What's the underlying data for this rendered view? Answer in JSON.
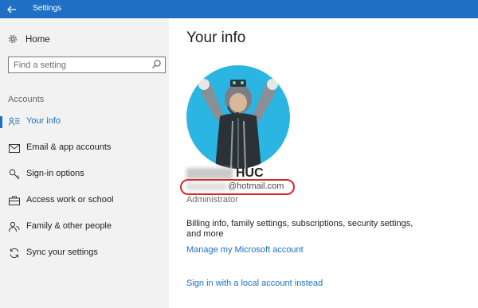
{
  "window": {
    "title": "Settings"
  },
  "sidebar": {
    "home_label": "Home",
    "search_placeholder": "Find a setting",
    "section_label": "Accounts",
    "items": [
      {
        "label": "Your info",
        "icon": "person-lines-icon",
        "active": true
      },
      {
        "label": "Email & app accounts",
        "icon": "mail-icon",
        "active": false
      },
      {
        "label": "Sign-in options",
        "icon": "key-icon",
        "active": false
      },
      {
        "label": "Access work or school",
        "icon": "briefcase-icon",
        "active": false
      },
      {
        "label": "Family & other people",
        "icon": "people-icon",
        "active": false
      },
      {
        "label": "Sync your settings",
        "icon": "sync-icon",
        "active": false
      }
    ]
  },
  "main": {
    "page_title": "Your info",
    "user_name_visible": "HUC",
    "email_visible": "@hotmail.com",
    "role": "Administrator",
    "description": "Billing info, family settings, subscriptions, security settings, and more",
    "manage_link": "Manage my Microsoft account",
    "local_account_link": "Sign in with a local account instead"
  },
  "colors": {
    "accent": "#1e6fc2",
    "titlebar": "#1f6fc4",
    "sidebar_bg": "#f2f2f2",
    "avatar_bg": "#2bb5e3",
    "highlight_ring": "#d9262a"
  }
}
